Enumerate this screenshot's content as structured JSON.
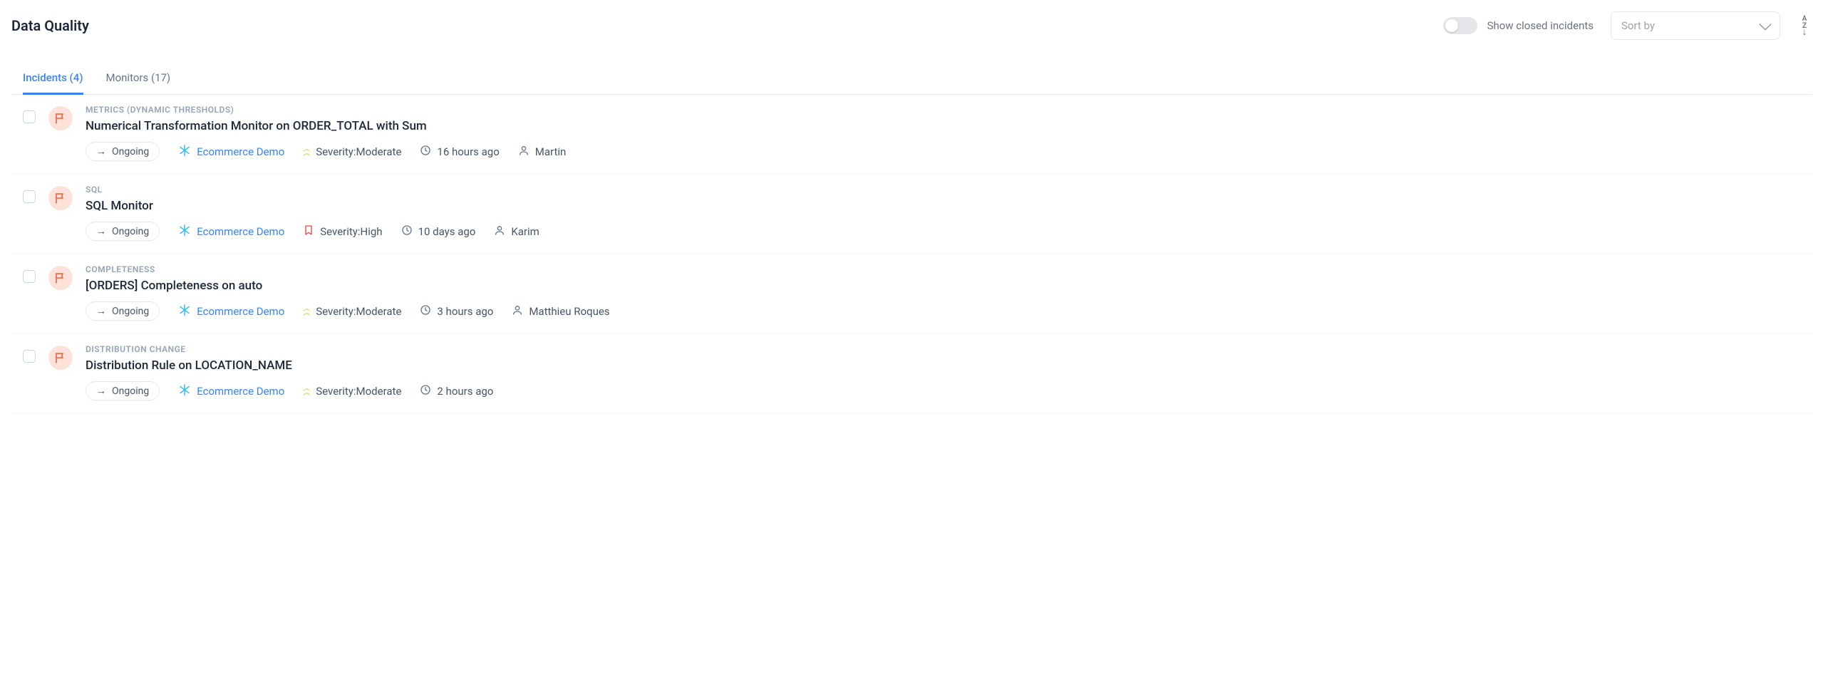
{
  "header": {
    "title": "Data Quality",
    "toggle_label": "Show closed incidents",
    "sort_placeholder": "Sort by"
  },
  "tabs": [
    {
      "label": "Incidents (4)",
      "active": true
    },
    {
      "label": "Monitors (17)",
      "active": false
    }
  ],
  "incidents": [
    {
      "category": "METRICS (DYNAMIC THRESHOLDS)",
      "title": "Numerical Transformation Monitor on ORDER_TOTAL with Sum",
      "status": "Ongoing",
      "source": "Ecommerce Demo",
      "severity_label": "Severity:Moderate",
      "severity_level": "moderate",
      "time": "16 hours ago",
      "assignee": "Martin"
    },
    {
      "category": "SQL",
      "title": "SQL Monitor",
      "status": "Ongoing",
      "source": "Ecommerce Demo",
      "severity_label": "Severity:High",
      "severity_level": "high",
      "time": "10 days ago",
      "assignee": "Karim"
    },
    {
      "category": "COMPLETENESS",
      "title": "[ORDERS] Completeness on auto",
      "status": "Ongoing",
      "source": "Ecommerce Demo",
      "severity_label": "Severity:Moderate",
      "severity_level": "moderate",
      "time": "3 hours ago",
      "assignee": "Matthieu Roques"
    },
    {
      "category": "DISTRIBUTION CHANGE",
      "title": "Distribution Rule on LOCATION_NAME",
      "status": "Ongoing",
      "source": "Ecommerce Demo",
      "severity_label": "Severity:Moderate",
      "severity_level": "moderate",
      "time": "2 hours ago",
      "assignee": null
    }
  ]
}
